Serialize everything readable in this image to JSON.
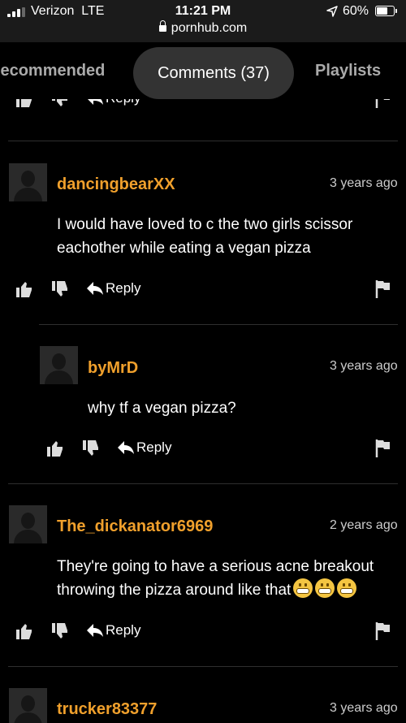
{
  "status_bar": {
    "carrier": "Verizon",
    "network": "LTE",
    "time": "11:21 PM",
    "url": "pornhub.com",
    "battery": "60%",
    "battery_level": 0.6
  },
  "tabs": [
    {
      "label": "Recommended"
    },
    {
      "label": "Comments (37)"
    },
    {
      "label": "Playlists"
    }
  ],
  "actions": {
    "reply_label": "Reply"
  },
  "comments": [
    {
      "username": "dancingbearXX",
      "time_ago": "3 years ago",
      "text": "I would have loved to c the two girls scissor eachother while eating a vegan pizza"
    },
    {
      "username": "byMrD",
      "time_ago": "3 years ago",
      "text": "why tf a vegan pizza?"
    },
    {
      "username": "The_dickanator6969",
      "time_ago": "2 years ago",
      "text": "They're going to have a serious acne breakout throwing the pizza around like that"
    },
    {
      "username": "trucker83377",
      "time_ago": "3 years ago",
      "text": ""
    }
  ],
  "icons": [
    "signal-icon",
    "lock-icon",
    "location-arrow-icon",
    "battery-icon",
    "thumbs-up-icon",
    "thumbs-down-icon",
    "reply-arrow-icon",
    "flag-icon",
    "grimacing-emoji-icon"
  ]
}
